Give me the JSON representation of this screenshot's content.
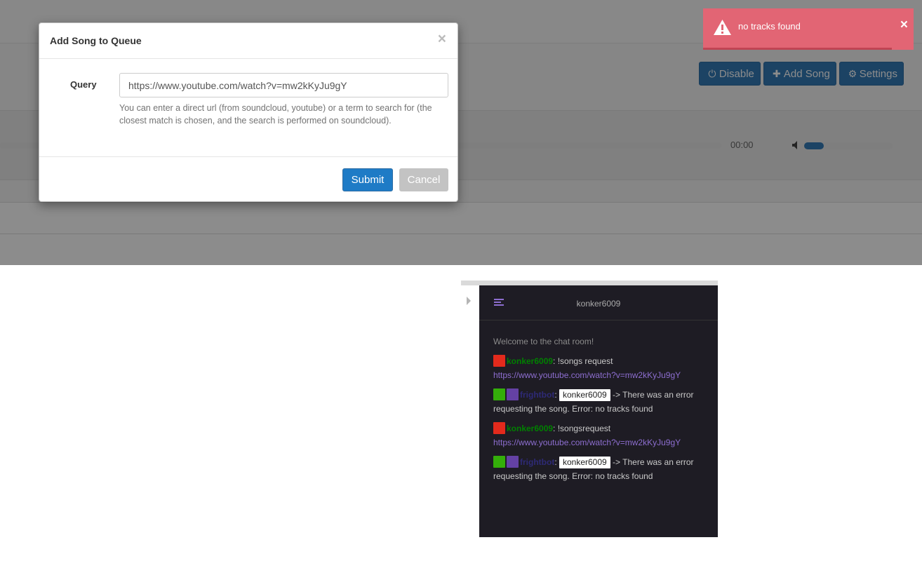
{
  "toolbar": {
    "disable_label": "Disable",
    "add_song_label": "Add Song",
    "settings_label": "Settings"
  },
  "player": {
    "time": "00:00",
    "progress": 0.0,
    "volume": 0.22
  },
  "toast": {
    "message": "no tracks found",
    "close": "×",
    "icon": "warning-icon"
  },
  "modal": {
    "title": "Add Song to Queue",
    "close": "×",
    "query_label": "Query",
    "query_value": "https://www.youtube.com/watch?v=mw2kKyJu9gY",
    "help_text": "You can enter a direct url (from soundcloud, youtube) or a term to search for (the closest match is chosen, and the search is performed on soundcloud).",
    "submit_label": "Submit",
    "cancel_label": "Cancel"
  },
  "chat": {
    "channel": "konker6009",
    "welcome": "Welcome to the chat room!",
    "messages": [
      {
        "user": "konker6009",
        "sep": ": ",
        "text": "!songs request ",
        "link": "https://www.youtube.com/watch?v=mw2kKyJu9gY"
      },
      {
        "user": "frightbot",
        "sep": ": ",
        "mention": "konker6009",
        "text": " -> There was an error requesting the song. Error: no tracks found"
      },
      {
        "user": "konker6009",
        "sep": ": ",
        "text": "!songsrequest ",
        "link": "https://www.youtube.com/watch?v=mw2kKyJu9gY"
      },
      {
        "user": "frightbot",
        "sep": ": ",
        "mention": "konker6009",
        "text": " -> There was an error requesting the song. Error: no tracks found"
      }
    ]
  },
  "colors": {
    "primary": "#337ab7",
    "toast_bg": "#e26574",
    "chat_bg": "#1e1c24",
    "link": "#8d6ed0"
  }
}
